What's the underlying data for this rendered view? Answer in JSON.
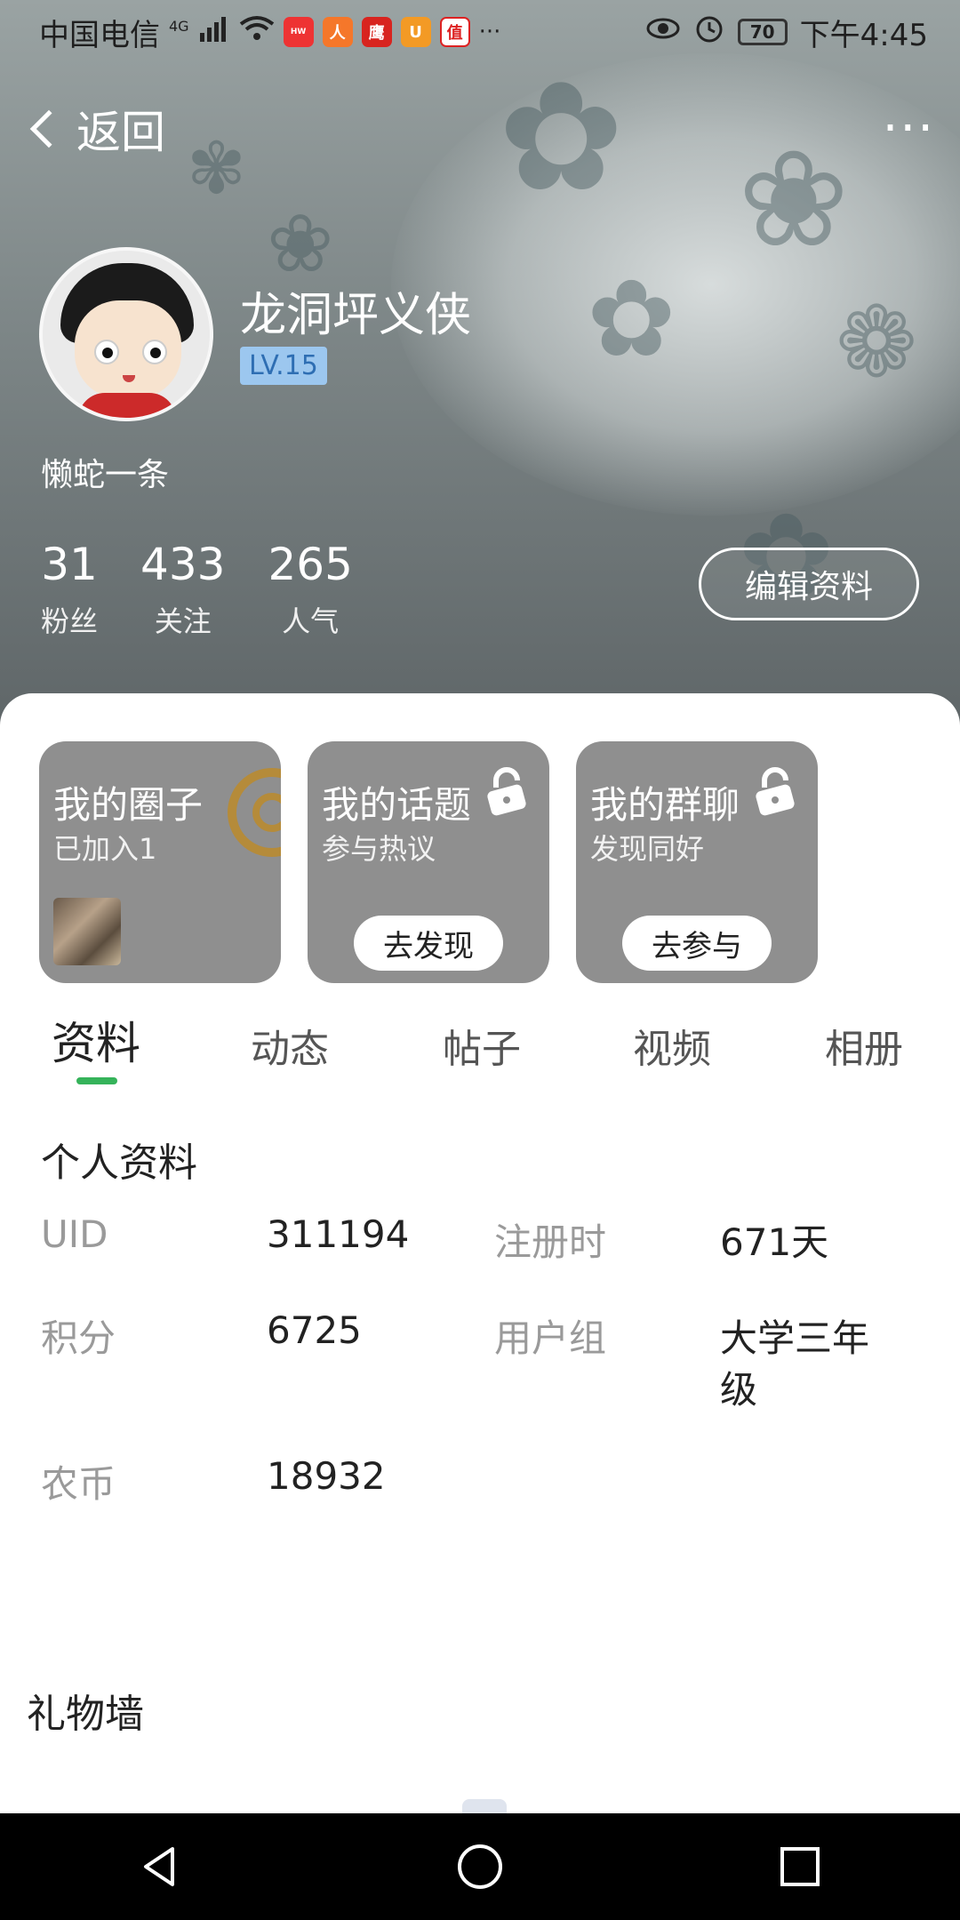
{
  "status_bar": {
    "carrier": "中国电信",
    "network": "4G",
    "battery": "70",
    "time": "下午4:45",
    "more": "···",
    "notification_icons": [
      "huawei-store-icon",
      "app-icon-2",
      "app-icon-3",
      "uc-browser-icon",
      "zhide-icon"
    ]
  },
  "topbar": {
    "back_label": "返回",
    "more_label": "···"
  },
  "profile": {
    "name": "龙洞坪义侠",
    "level": "LV.15",
    "signature": "懒蛇一条",
    "edit_label": "编辑资料",
    "stats": [
      {
        "num": "31",
        "label": "粉丝"
      },
      {
        "num": "433",
        "label": "关注"
      },
      {
        "num": "265",
        "label": "人气"
      }
    ]
  },
  "cards": [
    {
      "title": "我的圈子",
      "subtitle": "已加入1",
      "button": ""
    },
    {
      "title": "我的话题",
      "subtitle": "参与热议",
      "button": "去发现"
    },
    {
      "title": "我的群聊",
      "subtitle": "发现同好",
      "button": "去参与"
    }
  ],
  "tabs": [
    "资料",
    "动态",
    "帖子",
    "视频",
    "相册"
  ],
  "info_section": {
    "title": "个人资料",
    "rows": [
      {
        "k1": "UID",
        "v1": "311194",
        "k2": "注册时",
        "v2": "671天"
      },
      {
        "k1": "积分",
        "v1": "6725",
        "k2": "用户组",
        "v2a": "大学三年",
        "v2b": "级"
      },
      {
        "k1": "农币",
        "v1": "18932"
      }
    ]
  },
  "gift_wall": {
    "title": "礼物墙"
  },
  "colors": {
    "accent": "#35b35a",
    "level_bg": "#9cc7ef",
    "card_bg": "#8f8f8f"
  }
}
